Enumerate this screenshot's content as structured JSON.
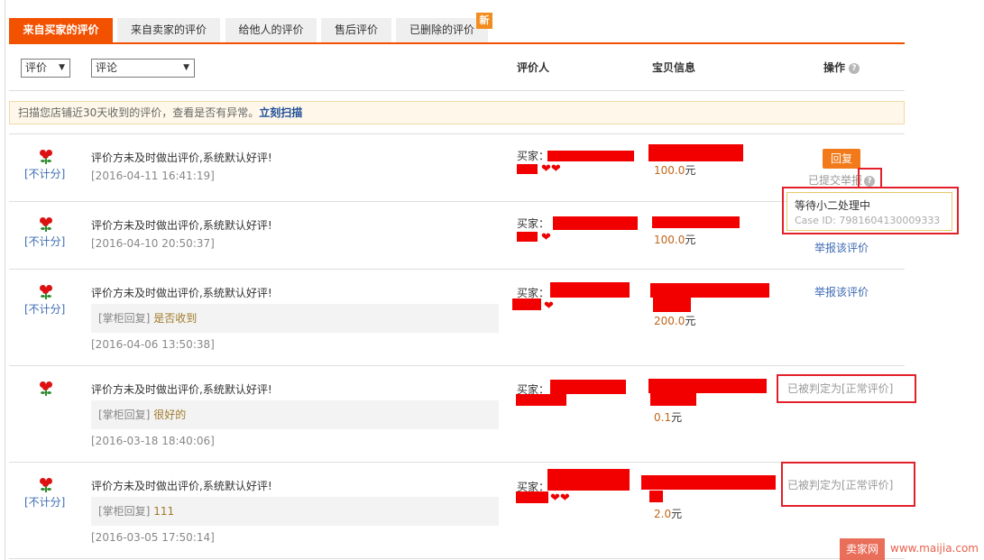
{
  "tabs": [
    {
      "label": "来自买家的评价",
      "active": true
    },
    {
      "label": "来自卖家的评价",
      "active": false
    },
    {
      "label": "给他人的评价",
      "active": false
    },
    {
      "label": "售后评价",
      "active": false
    },
    {
      "label": "已删除的评价",
      "active": false
    }
  ],
  "new_badge": "新",
  "filters": {
    "rating_select": "评价",
    "comment_select": "评论"
  },
  "columns": {
    "reviewer": "评价人",
    "item_info": "宝贝信息",
    "actions": "操作"
  },
  "notice": {
    "text": "扫描您店铺近30天收到的评价，查看是否有异常。",
    "link": "立刻扫描"
  },
  "rows": [
    {
      "no_count": "[不计分]",
      "comment": "评价方未及时做出评价,系统默认好评!",
      "date": "[2016-04-11 16:41:19]",
      "buyer": "买家：",
      "price": "100.0",
      "unit": "元",
      "reply_btn": "回复",
      "status": "已提交举报"
    },
    {
      "no_count": "[不计分]",
      "comment": "评价方未及时做出评价,系统默认好评!",
      "date": "[2016-04-10 20:50:37]",
      "buyer": "买家：",
      "price": "100.0",
      "unit": "元",
      "report_link": "举报该评价"
    },
    {
      "no_count": "[不计分]",
      "comment": "评价方未及时做出评价,系统默认好评!",
      "reply_label": "[掌柜回复]",
      "reply_text": "是否收到",
      "date": "[2016-04-06 13:50:38]",
      "buyer": "买家：",
      "price": "200.0",
      "unit": "元",
      "report_link": "举报该评价"
    },
    {
      "comment": "评价方未及时做出评价,系统默认好评!",
      "reply_label": "[掌柜回复]",
      "reply_text": "很好的",
      "date": "[2016-03-18 18:40:06]",
      "buyer": "买家：",
      "price": "0.1",
      "unit": "元",
      "judged": "已被判定为[正常评价]"
    },
    {
      "no_count": "[不计分]",
      "comment": "评价方未及时做出评价,系统默认好评!",
      "reply_label": "[掌柜回复]",
      "reply_text": "111",
      "date": "[2016-03-05 17:50:14]",
      "buyer": "买家：",
      "price": "2.0",
      "unit": "元",
      "judged": "已被判定为[正常评价]"
    }
  ],
  "tooltip": {
    "status": "等待小二处理中",
    "case_id": "Case ID: 7981604130009333"
  },
  "watermark": {
    "logo": "卖家网",
    "url": "www.maijia.com"
  },
  "colors": {
    "accent": "#f25100",
    "link": "#3d6bb3",
    "redact": "#f20000",
    "annotation": "#e2202a"
  }
}
